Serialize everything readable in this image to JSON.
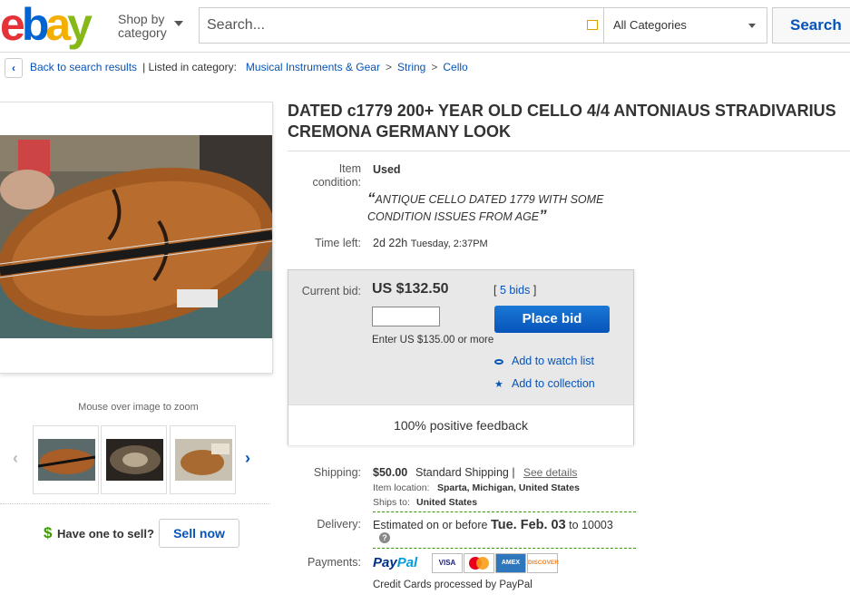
{
  "header": {
    "logo": {
      "e": "e",
      "b": "b",
      "a": "a",
      "y": "y"
    },
    "shop_by_line1": "Shop by",
    "shop_by_line2": "category",
    "search_placeholder": "Search...",
    "category_selected": "All Categories",
    "search_button": "Search"
  },
  "breadcrumb": {
    "back_label": "Back to search results",
    "listed_in": "| Listed in category:",
    "crumbs": [
      "Musical Instruments & Gear",
      "String",
      "Cello"
    ],
    "separator": ">"
  },
  "gallery": {
    "zoom_hint": "Mouse over image to zoom",
    "thumbnail_count": 3
  },
  "sell": {
    "prompt": "Have one to sell?",
    "button": "Sell now"
  },
  "listing": {
    "title_line1": "DATED c1779 200+ YEAR OLD CELLO 4/4 ANTONIAUS STRADIVARIUS",
    "title_line2": "CREMONA GERMANY LOOK",
    "condition_label_1": "Item",
    "condition_label_2": "condition:",
    "condition_value": "Used",
    "seller_note_line1": "ANTIQUE CELLO DATED 1779 WITH SOME",
    "seller_note_line2": "CONDITION ISSUES FROM AGE",
    "open_quote": "“",
    "close_quote": "”",
    "time_left_label": "Time left:",
    "time_left_value": "2d 22h",
    "end_time": "Tuesday, 2:37PM"
  },
  "bid": {
    "current_bid_label": "Current bid:",
    "price": "US $132.50",
    "bids_open": "[",
    "bids_link": "5 bids",
    "bids_close": "]",
    "place_bid_button": "Place bid",
    "enter_hint": "Enter US $135.00 or more",
    "watch_link": "Add to watch list",
    "collection_link": "Add to collection",
    "feedback": "100% positive feedback"
  },
  "shipping": {
    "label": "Shipping:",
    "price": "$50.00",
    "type": "Standard Shipping |",
    "details_link": "See details",
    "location_label": "Item location:",
    "location_value": "Sparta, Michigan, United States",
    "ships_to_label": "Ships to:",
    "ships_to_value": "United States"
  },
  "delivery": {
    "label": "Delivery:",
    "prefix": "Estimated on or before",
    "date": "Tue. Feb. 03",
    "suffix": "to 10003",
    "help": "?"
  },
  "payments": {
    "label": "Payments:",
    "paypal_a": "Pay",
    "paypal_b": "Pal",
    "cards": [
      "VISA",
      "MC",
      "AMEX",
      "DISCOVER"
    ],
    "note": "Credit Cards processed by PayPal"
  },
  "colors": {
    "link": "#0654ba",
    "place_bid": "#0654ba",
    "logo_e": "#e53238",
    "logo_b": "#0064d2",
    "logo_a": "#f5af02",
    "logo_y": "#86b817"
  }
}
